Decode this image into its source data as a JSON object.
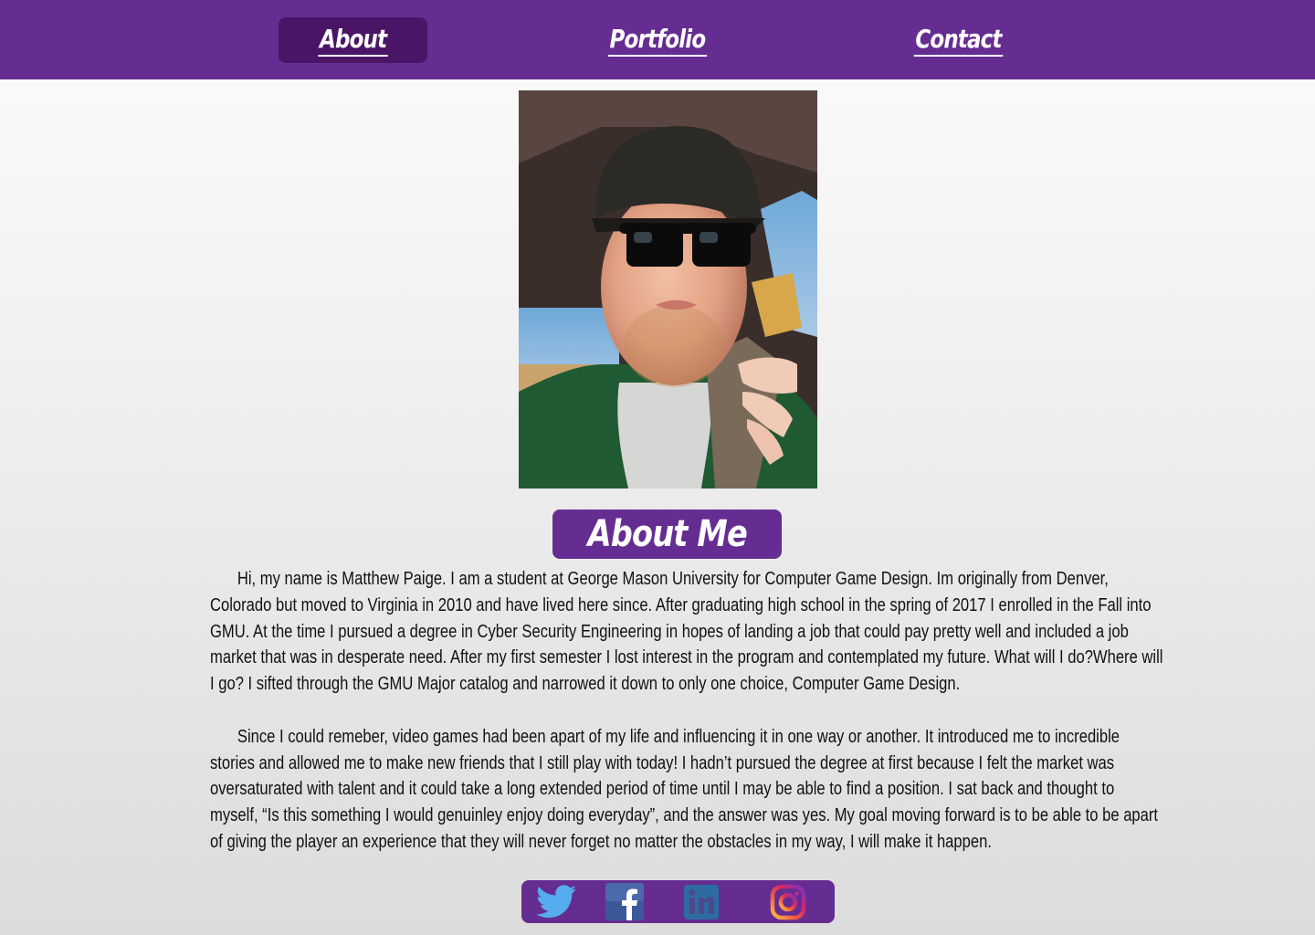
{
  "nav": {
    "items": [
      {
        "label": "About",
        "active": true
      },
      {
        "label": "Portfolio",
        "active": false
      },
      {
        "label": "Contact",
        "active": false
      }
    ]
  },
  "main": {
    "heading": "About Me",
    "paragraphs": [
      "Hi, my name is Matthew Paige. I am a student at George Mason University for Computer Game Design. Im originally from Denver, Colorado but moved to Virginia in 2010 and have lived here since. After graduating high school in the spring of 2017 I enrolled in the Fall into GMU. At the time I pursued a degree in Cyber Security Engineering in hopes of landing a job that could pay pretty well and included a job market that was in desperate need. After my first semester I lost interest in the program and contemplated my future. What will I do?Where will I go? I sifted through the GMU Major catalog and narrowed it down to only one choice, Computer Game Design.",
      "Since I could remeber, video games had been apart of my life and influencing it in one way or another. It introduced me to incredible stories and allowed me to make new friends that I still play with today! I hadn’t pursued the degree at first because I felt the market was oversaturated with talent and it could take a long extended period of time until  I may be able to find a position. I sat back and thought to myself, “Is this something I would genuinley enjoy doing everyday”, and the answer was yes. My goal moving forward is to be able to be apart of giving the player an experience that they will never forget no matter the obstacles in my way, I will make it happen."
    ]
  },
  "social": {
    "icons": [
      "twitter-icon",
      "facebook-icon",
      "linkedin-icon",
      "instagram-icon"
    ]
  },
  "colors": {
    "brand_purple": "#652d91",
    "active_tab": "#4a1566",
    "twitter_blue": "#55acee",
    "facebook_blue": "#3b5998",
    "linkedin_blue": "#2d6ca2"
  }
}
